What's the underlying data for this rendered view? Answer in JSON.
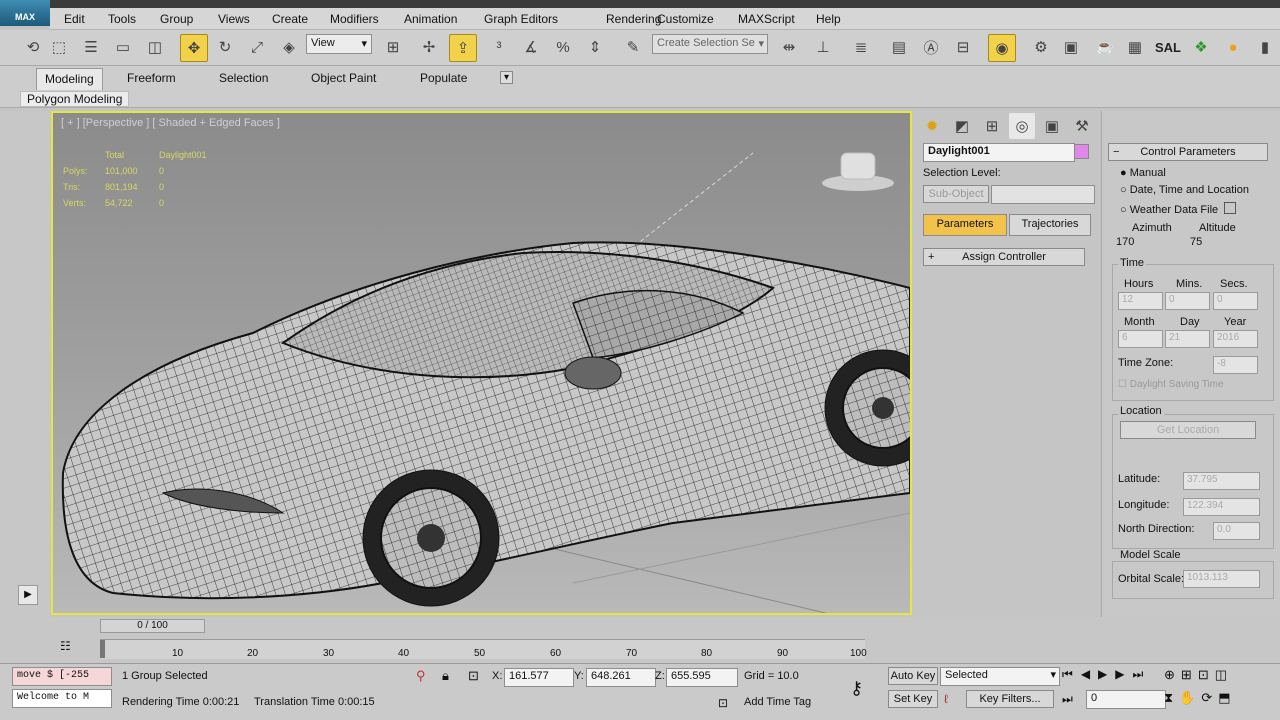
{
  "app": {
    "logo": "MAX"
  },
  "menu": [
    "Edit",
    "Tools",
    "Group",
    "Views",
    "Create",
    "Modifiers",
    "Animation",
    "Graph Editors",
    "Rendering",
    "Customize",
    "MAXScript",
    "Help"
  ],
  "toolbar": {
    "view_dropdown": "View",
    "selection_set_placeholder": "Create Selection Se",
    "icons": [
      "undo-icon",
      "select-icon",
      "select-by-name-icon",
      "rect-region-icon",
      "window-crossing-icon",
      "select-move-icon",
      "rotate-icon",
      "scale-icon",
      "placement-icon",
      "ref-coord-icon",
      "pivot-icon",
      "select-manipulate-icon",
      "keyboard-shortcut-icon",
      "snap-icon",
      "angle-snap-icon",
      "percent-snap-icon",
      "spinner-snap-icon",
      "edit-named-sel-icon",
      "mirror-icon",
      "align-icon",
      "layers-icon",
      "scene-explorer-icon",
      "curve-editor-icon",
      "schematic-icon",
      "material-editor-icon",
      "render-setup-icon",
      "rendered-frame-icon",
      "render-icon",
      "teapot-icon",
      "render-production-icon",
      "graphite-icon",
      "mesh-icon",
      "sun-icon",
      "more-icon"
    ],
    "sal_label": "SAL"
  },
  "ribbon": {
    "tabs": [
      "Modeling",
      "Freeform",
      "Selection",
      "Object Paint",
      "Populate"
    ],
    "active_tab": "Modeling",
    "panel_label": "Polygon Modeling"
  },
  "viewport": {
    "label": "[ + ] [Perspective ] [ Shaded + Edged Faces ]",
    "stats": {
      "header": [
        "Total",
        "Daylight001"
      ],
      "rows": [
        {
          "name": "Polys:",
          "total": "101,000",
          "obj": "0"
        },
        {
          "name": "Tris:",
          "total": "801,194",
          "obj": "0"
        },
        {
          "name": "Verts:",
          "total": "54,722",
          "obj": "0"
        }
      ]
    }
  },
  "command_panel": {
    "object_name": "Daylight001",
    "selection_level_label": "Selection Level:",
    "sub_object_button": "Sub-Object",
    "tabs": [
      "Parameters",
      "Trajectories"
    ],
    "active_tab": "Parameters",
    "assign_controller": "Assign Controller"
  },
  "control_params": {
    "title": "Control Parameters",
    "options": [
      "Manual",
      "Date, Time and Location",
      "Weather Data File"
    ],
    "selected_option": "Manual",
    "azimuth_label": "Azimuth",
    "altitude_label": "Altitude",
    "azimuth": "170",
    "altitude": "75",
    "time_group": "Time",
    "hours_label": "Hours",
    "mins_label": "Mins.",
    "secs_label": "Secs.",
    "hours": "12",
    "mins": "0",
    "secs": "0",
    "month_label": "Month",
    "day_label": "Day",
    "year_label": "Year",
    "month": "6",
    "day": "21",
    "year": "2016",
    "timezone_label": "Time Zone:",
    "timezone": "-8",
    "daylight_saving": "Daylight Saving Time",
    "location_group": "Location",
    "get_location": "Get Location",
    "latitude_label": "Latitude:",
    "latitude": "37.795",
    "longitude_label": "Longitude:",
    "longitude": "122.394",
    "north_label": "North Direction:",
    "north": "0.0",
    "model_scale_group": "Model Scale",
    "orbital_label": "Orbital Scale:",
    "orbital": "1013.113"
  },
  "timeline": {
    "frame": "0 / 100",
    "ticks": [
      "10",
      "20",
      "30",
      "40",
      "50",
      "60",
      "70",
      "80",
      "90",
      "100"
    ]
  },
  "status": {
    "script_line1": "move $ [-255",
    "script_line2": "Welcome to M",
    "selection": "1 Group Selected",
    "rendering_time": "Rendering Time  0:00:21",
    "translation_time": "Translation Time  0:00:15",
    "x_label": "X:",
    "x": "161.577",
    "y_label": "Y:",
    "y": "648.261",
    "z_label": "Z:",
    "z": "655.595",
    "grid": "Grid = 10.0",
    "add_time_tag": "Add Time Tag",
    "auto_key": "Auto Key",
    "set_key": "Set Key",
    "key_mode": "Selected",
    "key_filters": "Key Filters...",
    "current_frame": "0"
  }
}
